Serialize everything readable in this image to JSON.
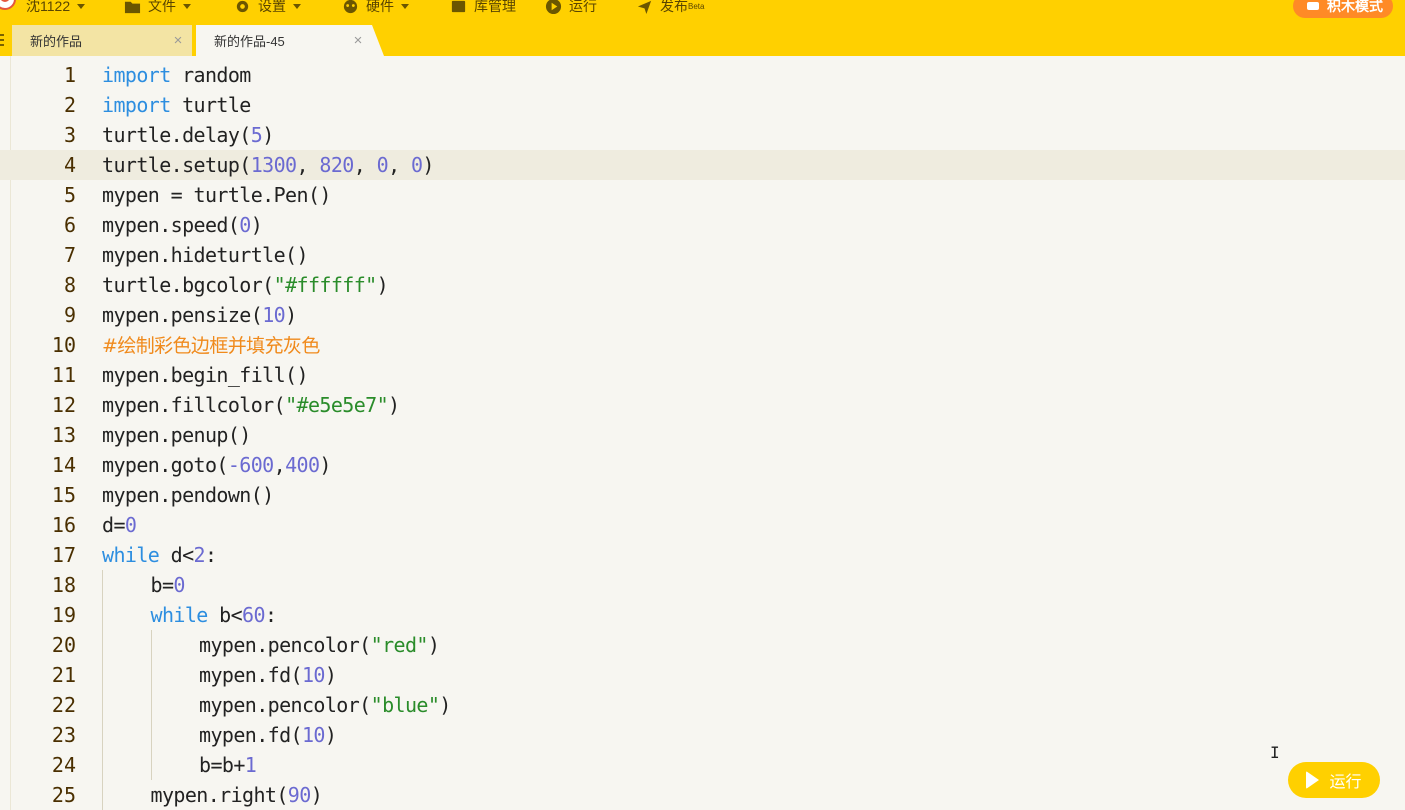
{
  "menubar": {
    "user_name": "沈1122",
    "file_label": "文件",
    "settings_label": "设置",
    "hardware_label": "硬件",
    "library_label": "库管理",
    "run_label": "运行",
    "publish_label": "发布",
    "publish_badge": "Beta",
    "mode_button_label": "积木模式"
  },
  "tabs": [
    {
      "label": "新的作品",
      "active": false
    },
    {
      "label": "新的作品-45",
      "active": true
    }
  ],
  "editor": {
    "current_line": 4,
    "lines": [
      {
        "n": "1",
        "indent": 0,
        "tokens": [
          [
            "kw",
            "import"
          ],
          [
            "t",
            " random"
          ]
        ]
      },
      {
        "n": "2",
        "indent": 0,
        "tokens": [
          [
            "kw",
            "import"
          ],
          [
            "t",
            " turtle"
          ]
        ]
      },
      {
        "n": "3",
        "indent": 0,
        "tokens": [
          [
            "t",
            "turtle.delay("
          ],
          [
            "num",
            "5"
          ],
          [
            "t",
            ")"
          ]
        ]
      },
      {
        "n": "4",
        "indent": 0,
        "tokens": [
          [
            "t",
            "turtle.setup("
          ],
          [
            "num",
            "1300"
          ],
          [
            "t",
            ", "
          ],
          [
            "num",
            "820"
          ],
          [
            "t",
            ", "
          ],
          [
            "num",
            "0"
          ],
          [
            "t",
            ", "
          ],
          [
            "num",
            "0"
          ],
          [
            "t",
            ")"
          ]
        ]
      },
      {
        "n": "5",
        "indent": 0,
        "tokens": [
          [
            "t",
            "mypen = turtle.Pen()"
          ]
        ]
      },
      {
        "n": "6",
        "indent": 0,
        "tokens": [
          [
            "t",
            "mypen.speed("
          ],
          [
            "num",
            "0"
          ],
          [
            "t",
            ")"
          ]
        ]
      },
      {
        "n": "7",
        "indent": 0,
        "tokens": [
          [
            "t",
            "mypen.hideturtle()"
          ]
        ]
      },
      {
        "n": "8",
        "indent": 0,
        "tokens": [
          [
            "t",
            "turtle.bgcolor("
          ],
          [
            "str",
            "\"#ffffff\""
          ],
          [
            "t",
            ")"
          ]
        ]
      },
      {
        "n": "9",
        "indent": 0,
        "tokens": [
          [
            "t",
            "mypen.pensize("
          ],
          [
            "num",
            "10"
          ],
          [
            "t",
            ")"
          ]
        ]
      },
      {
        "n": "10",
        "indent": 0,
        "tokens": [
          [
            "cmt",
            "#绘制彩色边框并填充灰色"
          ]
        ]
      },
      {
        "n": "11",
        "indent": 0,
        "tokens": [
          [
            "t",
            "mypen.begin_fill()"
          ]
        ]
      },
      {
        "n": "12",
        "indent": 0,
        "tokens": [
          [
            "t",
            "mypen.fillcolor("
          ],
          [
            "str",
            "\"#e5e5e7\""
          ],
          [
            "t",
            ")"
          ]
        ]
      },
      {
        "n": "13",
        "indent": 0,
        "tokens": [
          [
            "t",
            "mypen.penup()"
          ]
        ]
      },
      {
        "n": "14",
        "indent": 0,
        "tokens": [
          [
            "t",
            "mypen.goto("
          ],
          [
            "num",
            "-600"
          ],
          [
            "t",
            ","
          ],
          [
            "num",
            "400"
          ],
          [
            "t",
            ")"
          ]
        ]
      },
      {
        "n": "15",
        "indent": 0,
        "tokens": [
          [
            "t",
            "mypen.pendown()"
          ]
        ]
      },
      {
        "n": "16",
        "indent": 0,
        "tokens": [
          [
            "t",
            "d="
          ],
          [
            "num",
            "0"
          ]
        ]
      },
      {
        "n": "17",
        "indent": 0,
        "tokens": [
          [
            "kw",
            "while"
          ],
          [
            "t",
            " d<"
          ],
          [
            "num",
            "2"
          ],
          [
            "t",
            ":"
          ]
        ]
      },
      {
        "n": "18",
        "indent": 1,
        "tokens": [
          [
            "t",
            "b="
          ],
          [
            "num",
            "0"
          ]
        ]
      },
      {
        "n": "19",
        "indent": 1,
        "tokens": [
          [
            "kw",
            "while"
          ],
          [
            "t",
            " b<"
          ],
          [
            "num",
            "60"
          ],
          [
            "t",
            ":"
          ]
        ]
      },
      {
        "n": "20",
        "indent": 2,
        "tokens": [
          [
            "t",
            "mypen.pencolor("
          ],
          [
            "str",
            "\"red\""
          ],
          [
            "t",
            ")"
          ]
        ]
      },
      {
        "n": "21",
        "indent": 2,
        "tokens": [
          [
            "t",
            "mypen.fd("
          ],
          [
            "num",
            "10"
          ],
          [
            "t",
            ")"
          ]
        ]
      },
      {
        "n": "22",
        "indent": 2,
        "tokens": [
          [
            "t",
            "mypen.pencolor("
          ],
          [
            "str",
            "\"blue\""
          ],
          [
            "t",
            ")"
          ]
        ]
      },
      {
        "n": "23",
        "indent": 2,
        "tokens": [
          [
            "t",
            "mypen.fd("
          ],
          [
            "num",
            "10"
          ],
          [
            "t",
            ")"
          ]
        ]
      },
      {
        "n": "24",
        "indent": 2,
        "tokens": [
          [
            "t",
            "b=b+"
          ],
          [
            "num",
            "1"
          ]
        ]
      },
      {
        "n": "25",
        "indent": 1,
        "tokens": [
          [
            "t",
            "mypen.right("
          ],
          [
            "num",
            "90"
          ],
          [
            "t",
            ")"
          ]
        ]
      }
    ]
  },
  "run_float_label": "运行",
  "colors": {
    "accent": "#ffd000",
    "mode_button": "#ff8a26",
    "keyword": "#2d8ee0",
    "number": "#6b6ad1",
    "string": "#2a8c2a",
    "comment": "#f08a1c"
  },
  "icons": [
    "avatar",
    "folder-icon",
    "gear-icon",
    "hardware-icon",
    "library-icon",
    "run-icon",
    "publish-icon",
    "close-icon",
    "play-icon"
  ]
}
